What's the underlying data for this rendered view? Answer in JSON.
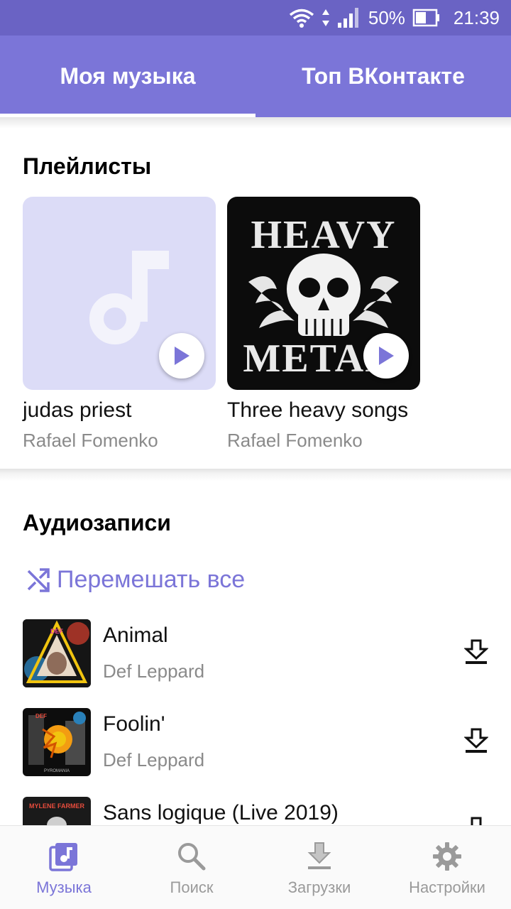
{
  "status_bar": {
    "battery": "50%",
    "time": "21:39"
  },
  "tabs": [
    {
      "label": "Моя музыка",
      "active": true
    },
    {
      "label": "Топ ВКонтакте",
      "active": false
    }
  ],
  "playlists_section": {
    "title": "Плейлисты",
    "items": [
      {
        "title": "judas priest",
        "owner": "Rafael Fomenko",
        "cover": "music-note-placeholder"
      },
      {
        "title": "Three heavy songs",
        "owner": "Rafael Fomenko",
        "cover": "heavy-metal-skull",
        "cover_text_top": "HEAVY",
        "cover_text_bottom": "METAL"
      }
    ]
  },
  "audio_section": {
    "title": "Аудиозаписи",
    "shuffle_label": "Перемешать все",
    "tracks": [
      {
        "title": "Animal",
        "artist": "Def Leppard",
        "art": "hysteria-cover"
      },
      {
        "title": "Foolin'",
        "artist": "Def Leppard",
        "art": "pyromania-cover"
      },
      {
        "title": "Sans logique (Live 2019)",
        "artist": "",
        "art": "mylene-farmer-cover",
        "art_text": "MYLENE FARMER"
      }
    ]
  },
  "bottom_nav": [
    {
      "label": "Музыка",
      "icon": "music-library-icon",
      "active": true
    },
    {
      "label": "Поиск",
      "icon": "search-icon",
      "active": false
    },
    {
      "label": "Загрузки",
      "icon": "download-icon",
      "active": false
    },
    {
      "label": "Настройки",
      "icon": "gear-icon",
      "active": false
    }
  ],
  "colors": {
    "accent": "#7b75d8",
    "status_bar": "#6a63c4",
    "secondary_text": "#8a8a8a"
  }
}
